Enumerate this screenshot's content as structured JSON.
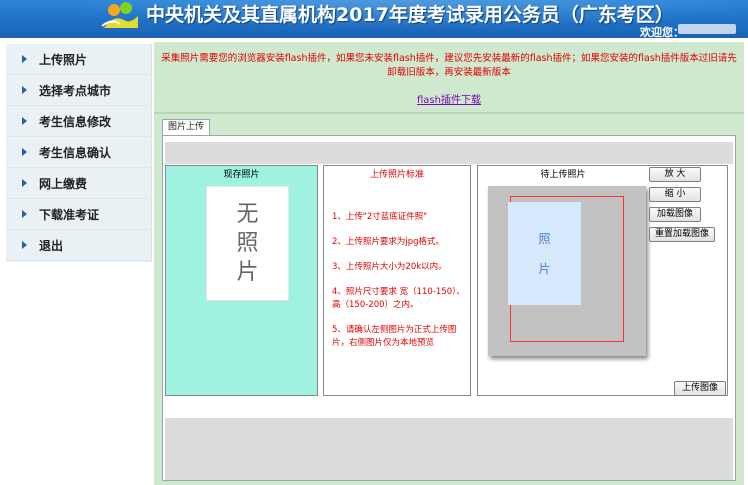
{
  "header": {
    "title": "中央机关及其直属机构2017年度考试录用公务员（广东考区）",
    "welcome": "欢迎您："
  },
  "sidebar": {
    "items": [
      {
        "label": "上传照片"
      },
      {
        "label": "选择考点城市"
      },
      {
        "label": "考生信息修改"
      },
      {
        "label": "考生信息确认"
      },
      {
        "label": "网上缴费"
      },
      {
        "label": "下载准考证"
      },
      {
        "label": "退出"
      }
    ]
  },
  "notice": {
    "text": "采集照片需要您的浏览器安装flash插件，如果您未安装flash插件，建议您先安装最新的flash插件；如果您安装的flash插件版本过旧请先卸载旧版本，再安装最新版本",
    "link": "flash插件下载"
  },
  "tab": {
    "label": "图片上传"
  },
  "current_photo": {
    "title": "现存照片",
    "placeholder": [
      "无",
      "照",
      "片"
    ]
  },
  "standards": {
    "title": "上传照片标准",
    "rules": [
      "1、上传\"2寸蓝底证件照\"",
      "2、上传照片要求为jpg格式。",
      "3、上传照片大小为20k以内。",
      "4、照片尺寸要求 宽（110-150）、高（150-200）之内。",
      "5、请确认左侧图片为正式上传图片，右侧图片仅为本地预览"
    ]
  },
  "pending_photo": {
    "title": "待上传照片",
    "placeholder": [
      "照",
      "片"
    ]
  },
  "buttons": {
    "zoom_in": "放 大",
    "zoom_out": "缩 小",
    "load": "加载图像",
    "reload": "重置加载图像",
    "upload": "上传图像"
  },
  "colors": {
    "header_blue": "#1f6fc4",
    "main_bg": "#cfe9cf",
    "notice_red": "#e00000",
    "current_photo_bg": "#9ef2df",
    "link_purple": "#7a0aa8"
  }
}
